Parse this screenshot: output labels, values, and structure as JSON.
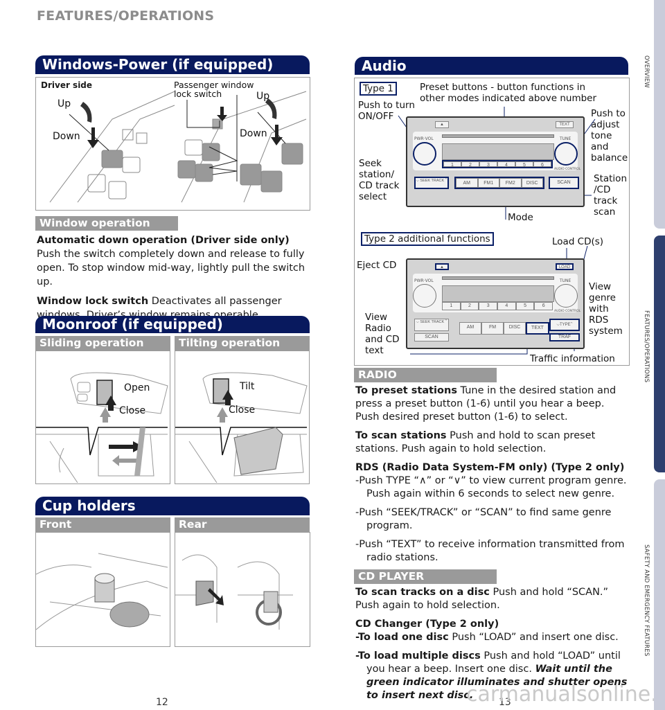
{
  "running_head": "FEATURES/OPERATIONS",
  "windows": {
    "title": "Windows-Power (if equipped)",
    "driver_side": "Driver side",
    "up_left": "Up",
    "down_left": "Down",
    "passenger_lock": "Passenger window lock switch",
    "up_right": "Up",
    "down_right": "Down",
    "subheading": "Window operation",
    "paragraphs": [
      {
        "bold": "Automatic down operation (Driver side only)",
        "text": " Push the switch completely down and release to fully open. To stop window mid-way, lightly pull the switch up."
      },
      {
        "bold": "Window lock switch",
        "text": " Deactivates all passenger windows. Driver’s window remains operable."
      }
    ]
  },
  "moonroof": {
    "title": "Moonroof (if equipped)",
    "sliding": "Sliding operation",
    "tilting": "Tilting operation",
    "open": "Open",
    "close_left": "Close",
    "tilt": "Tilt",
    "close_right": "Close"
  },
  "cupholders": {
    "title": "Cup holders",
    "front": "Front",
    "rear": "Rear"
  },
  "audio": {
    "title": "Audio",
    "type1": "Type 1",
    "preset_note": "Preset buttons - button functions in other modes indicated above number",
    "power": "Push to turn ON/OFF",
    "tone": "Push to adjust tone and balance",
    "seek": "Seek station/ CD track select",
    "scan": "Station /CD track scan",
    "mode": "Mode",
    "type2": "Type 2 additional functions",
    "load": "Load CD(s)",
    "eject": "Eject CD",
    "view_text": "View Radio and CD text",
    "view_genre": "View genre with RDS system",
    "traffic": "Traffic information",
    "radio_labels": {
      "pwr_vol": "PWR·VOL",
      "tune": "TUNE",
      "text": "TEXT",
      "load": "LOAD",
      "presets": [
        "1",
        "2",
        "3",
        "4",
        "5",
        "6"
      ],
      "type1_modes": [
        "AM",
        "FM1",
        "FM2",
        "DISC"
      ],
      "type2_modes": [
        "AM",
        "FM",
        "DISC",
        "TEXT"
      ],
      "seek_track": "SEEK TRACK",
      "scan": "SCAN",
      "type": "TYPE",
      "traf": "TRAF",
      "audio_control": "AUDIO CONTROL"
    }
  },
  "radio_section": {
    "heading": "RADIO",
    "preset": {
      "bold": "To preset stations",
      "text": " Tune in the desired station and press a preset button (1-6) until you hear a beep. Push desired preset button (1-6) to select."
    },
    "scan": {
      "bold": "To scan stations",
      "text": " Push and hold to scan preset stations. Push again to hold selection."
    },
    "rds_heading": "RDS (Radio Data System-FM only) (Type 2 only)",
    "rds_items": [
      "-Push TYPE “∧” or “∨” to view current program genre. Push again within 6 seconds to select new genre.",
      "-Push “SEEK/TRACK” or “SCAN” to find same genre program.",
      "-Push “TEXT” to receive information transmitted from radio stations."
    ]
  },
  "cd_section": {
    "heading": "CD PLAYER",
    "scan": {
      "bold": "To scan tracks on a disc",
      "text": " Push and hold “SCAN.” Push again to hold selection."
    },
    "changer_heading": "CD Changer (Type 2 only)",
    "load_one": {
      "bold": "-To load one disc",
      "text": " Push “LOAD” and insert one disc."
    },
    "load_multi": {
      "bold": "-To load multiple discs",
      "text": " Push and hold “LOAD” until you hear a beep. Insert one disc. ",
      "italic": "Wait until the green indicator illuminates and shutter opens to insert next disc."
    }
  },
  "side_tabs": [
    {
      "label": "OVERVIEW",
      "active": false
    },
    {
      "label": "FEATURES/OPERATIONS",
      "active": true
    },
    {
      "label": "SAFETY AND EMERGENCY FEATURES",
      "active": false
    }
  ],
  "page_numbers": {
    "left": "12",
    "right": "13"
  },
  "watermark": "carmanualsonline.info",
  "colors": {
    "header_navy": "#08195e",
    "subheading_gray": "#9a9a9a",
    "tab_active": "#2e3f6e",
    "tab_inactive": "#c9ccda"
  }
}
